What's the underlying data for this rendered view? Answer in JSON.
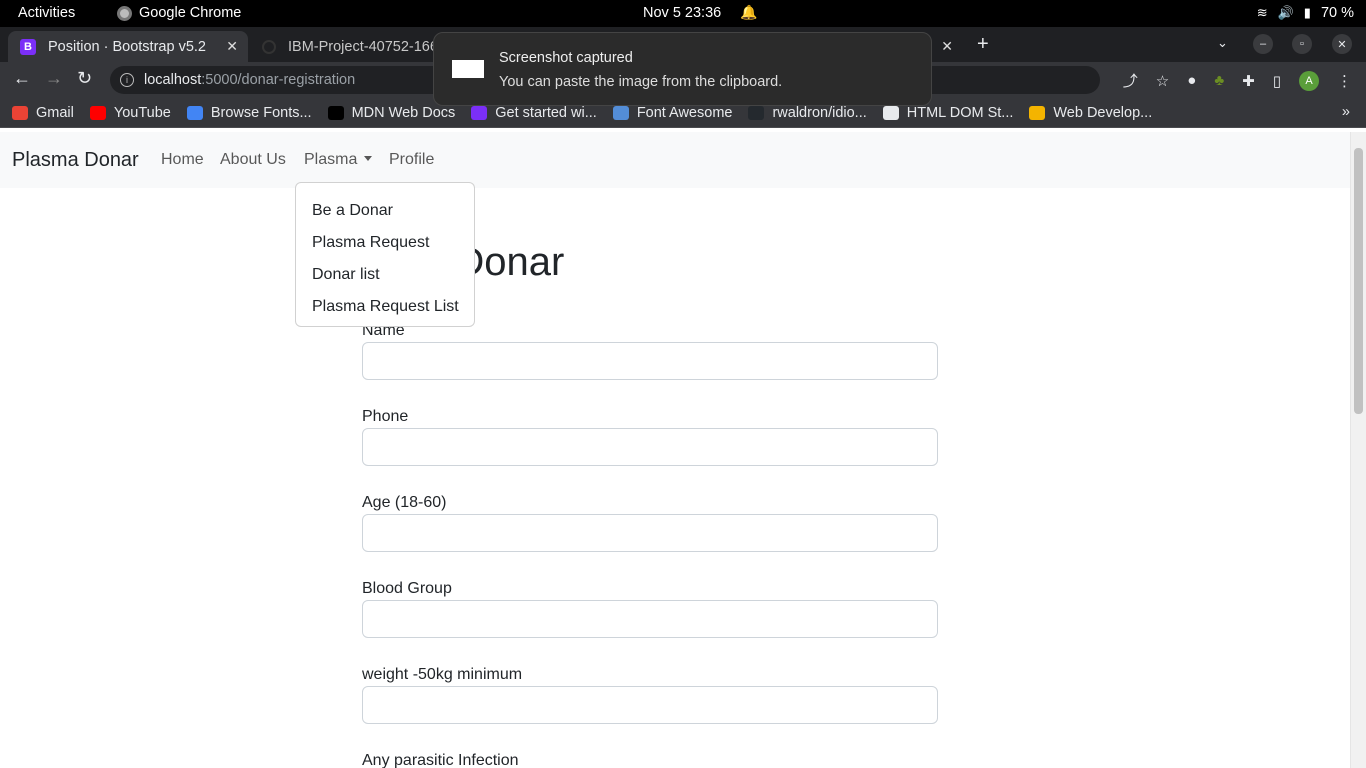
{
  "system_bar": {
    "activities": "Activities",
    "app_name": "Google Chrome",
    "clock": "Nov 5  23:36",
    "battery": "70 %"
  },
  "tabs": [
    {
      "title": "Position · Bootstrap v5.2",
      "favicon": "bootstrap-icon"
    },
    {
      "title": "IBM-Project-40752-166",
      "favicon": "github-icon"
    }
  ],
  "notification": {
    "title": "Screenshot captured",
    "body": "You can paste the image from the clipboard."
  },
  "omnibox": {
    "host": "localhost",
    "path": ":5000/donar-registration"
  },
  "bookmarks": [
    {
      "label": "Gmail",
      "icon": "gmail-icon",
      "color": "#ea4335"
    },
    {
      "label": "YouTube",
      "icon": "youtube-icon",
      "color": "#ff0000"
    },
    {
      "label": "Browse Fonts...",
      "icon": "google-fonts-icon",
      "color": "#4285f4"
    },
    {
      "label": "MDN Web Docs",
      "icon": "mdn-icon",
      "color": "#000000"
    },
    {
      "label": "Get started wi...",
      "icon": "bootstrap-icon",
      "color": "#7b2ff7"
    },
    {
      "label": "Font Awesome",
      "icon": "font-awesome-icon",
      "color": "#538dd7"
    },
    {
      "label": "rwaldron/idio...",
      "icon": "github-icon",
      "color": "#24292e"
    },
    {
      "label": "HTML DOM St...",
      "icon": "globe-icon",
      "color": "#e8eaed"
    },
    {
      "label": "Web Develop...",
      "icon": "web-dev-icon",
      "color": "#f4b400"
    }
  ],
  "navbar": {
    "brand": "Plasma Donar",
    "links": [
      "Home",
      "About Us",
      "Plasma",
      "Profile"
    ]
  },
  "dropdown": {
    "items": [
      "Be a Donar",
      "Plasma Request",
      "Donar list",
      "Plasma Request List"
    ]
  },
  "page": {
    "heading_visible": "Donar"
  },
  "form": {
    "fields": [
      {
        "label": "Name",
        "value": ""
      },
      {
        "label": "Phone",
        "value": ""
      },
      {
        "label": "Age (18-60)",
        "value": ""
      },
      {
        "label": "Blood Group",
        "value": ""
      },
      {
        "label": "weight -50kg minimum",
        "value": ""
      },
      {
        "label": "Any parasitic Infection",
        "value": ""
      }
    ]
  }
}
